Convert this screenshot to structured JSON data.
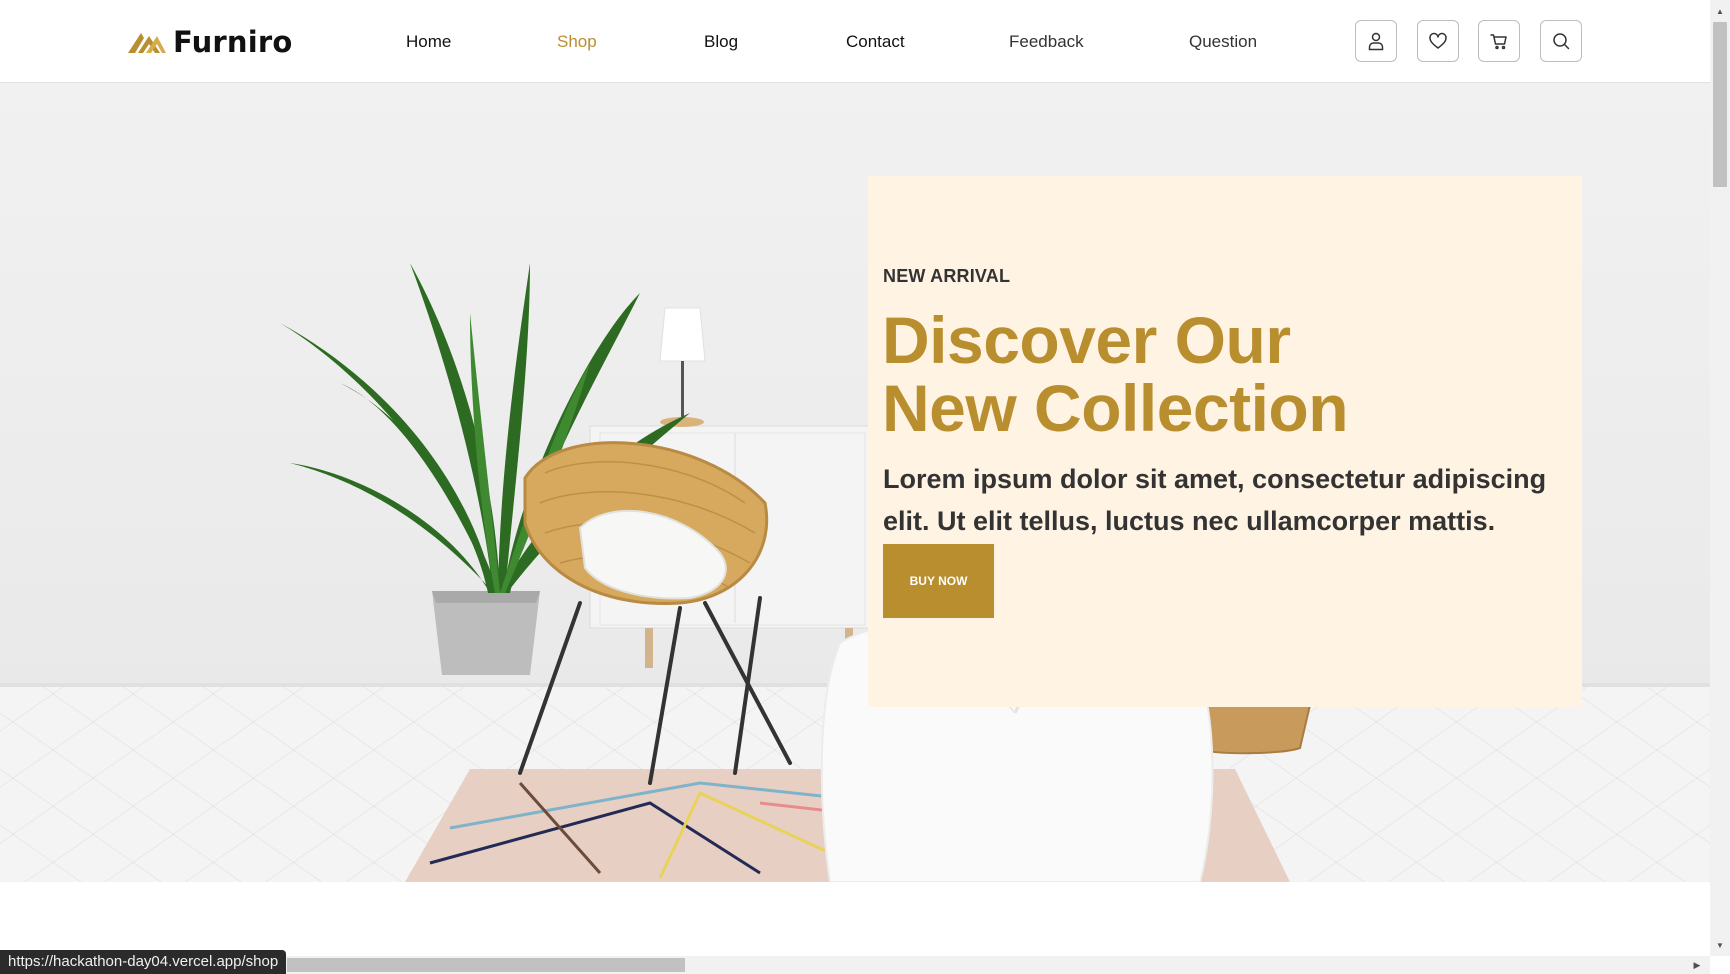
{
  "brand": {
    "name": "Furniro",
    "accent_color": "#b88e2f",
    "logo_icon": "double-mountain-logo"
  },
  "nav": {
    "items": [
      {
        "label": "Home",
        "state": "default"
      },
      {
        "label": "Shop",
        "state": "active"
      },
      {
        "label": "Blog",
        "state": "default"
      },
      {
        "label": "Contact",
        "state": "default"
      },
      {
        "label": "Feedback",
        "state": "muted"
      },
      {
        "label": "Question",
        "state": "muted"
      }
    ],
    "icons": [
      "user-icon",
      "heart-icon",
      "cart-icon",
      "search-icon"
    ]
  },
  "hero": {
    "eyebrow": "NEW ARRIVAL",
    "title_line1": "Discover Our",
    "title_line2": "New Collection",
    "description": "Lorem ipsum dolor sit amet, consectetur adipiscing elit. Ut elit tellus, luctus nec ullamcorper mattis.",
    "button_label": "BUY NOW",
    "card_color": "#fff3e3"
  },
  "browser": {
    "status_url": "https://hackathon-day04.vercel.app/shop"
  }
}
